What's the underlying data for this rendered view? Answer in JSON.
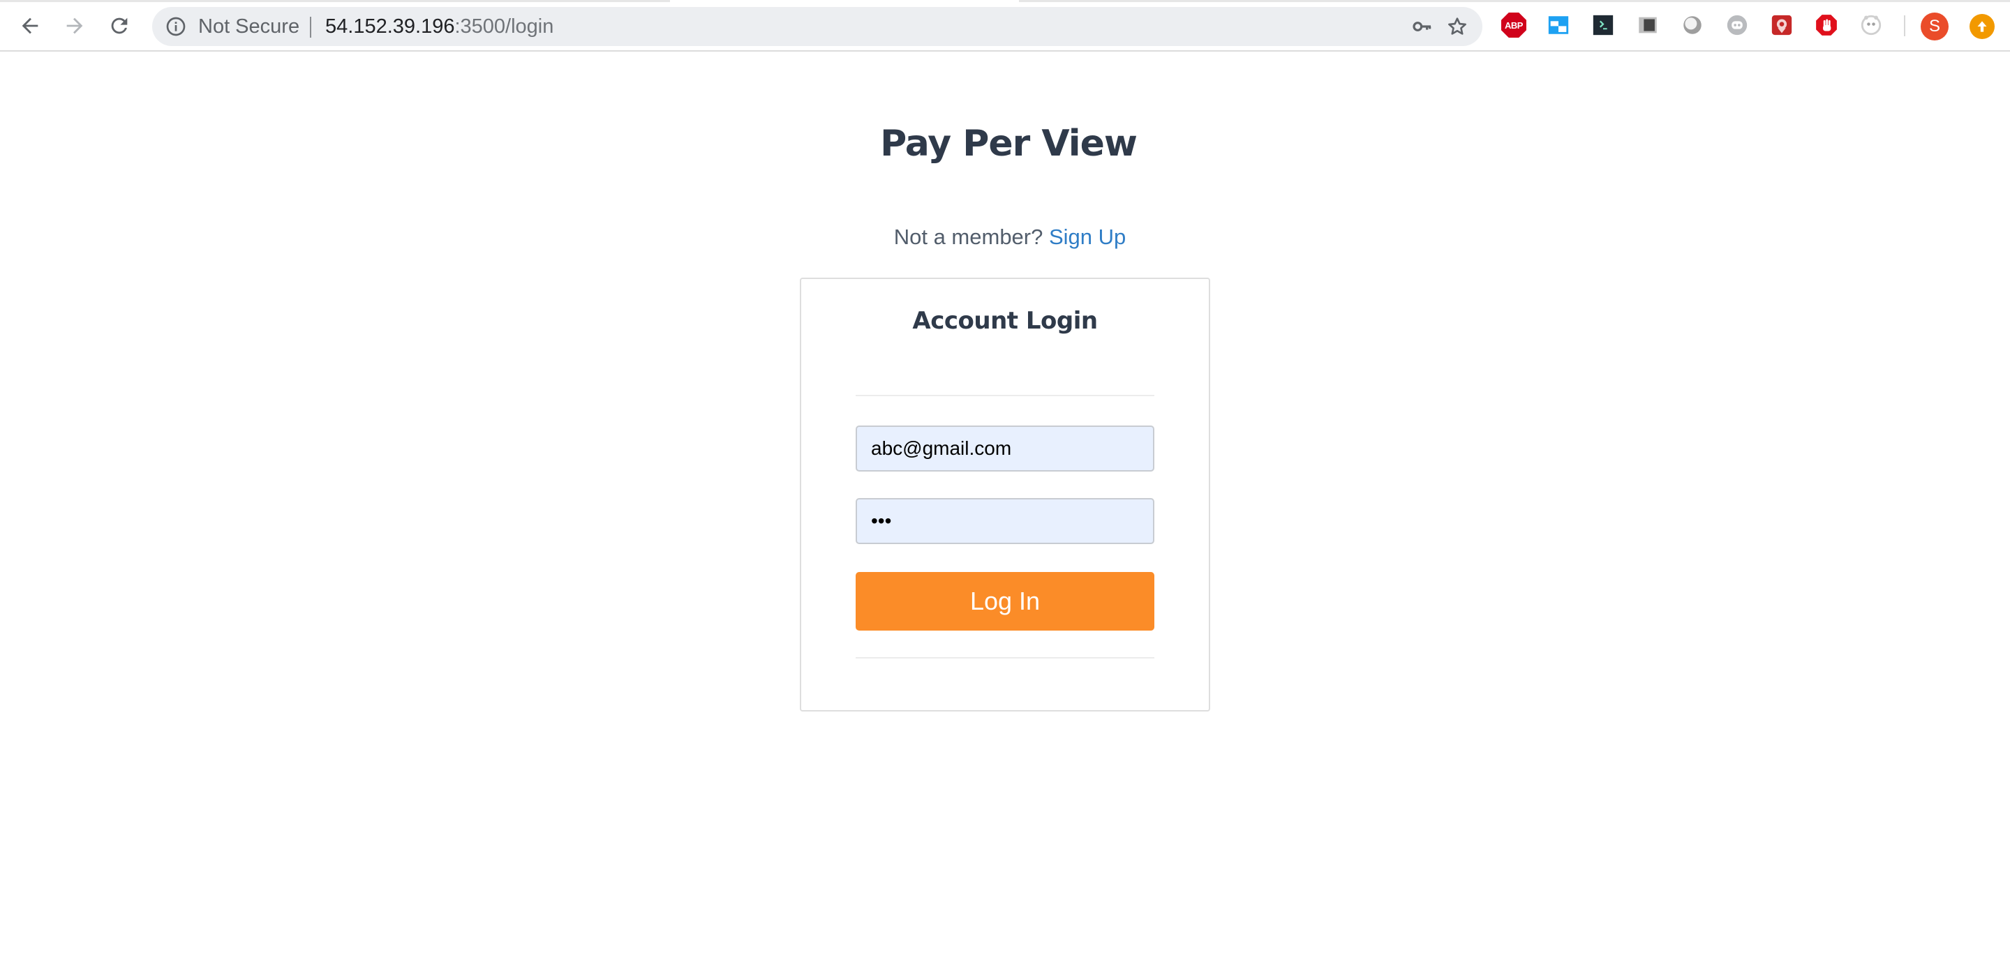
{
  "browser": {
    "security_label": "Not Secure",
    "url_host": "54.152.39.196",
    "url_rest": ":3500/login",
    "nav_icons": [
      "back-arrow-icon",
      "forward-arrow-icon",
      "reload-icon"
    ],
    "omnibox_icons": [
      "info-icon",
      "key-icon",
      "star-icon"
    ],
    "extensions": [
      {
        "name": "adblock-plus-icon",
        "label": "ABP",
        "color": "#d0021b"
      },
      {
        "name": "window-extension-icon",
        "color": "#1da1f2"
      },
      {
        "name": "terminal-extension-icon",
        "color": "#1f2a33"
      },
      {
        "name": "film-extension-icon",
        "color": "#555555"
      },
      {
        "name": "circle-extension-icon",
        "color": "#9e9e9e"
      },
      {
        "name": "discord-extension-icon",
        "color": "#b9bbbe"
      },
      {
        "name": "puzzle-red-extension-icon",
        "color": "#c62828"
      },
      {
        "name": "hand-stop-extension-icon",
        "color": "#e0101c"
      },
      {
        "name": "panda-extension-icon",
        "color": "#cfcfcf"
      }
    ],
    "avatar_letter": "S",
    "avatar_color": "#ea4c2a",
    "update_icon": "arrow-up-icon",
    "update_color": "#f29900"
  },
  "page": {
    "title": "Pay Per View",
    "signup_prompt": "Not a member?",
    "signup_link": "Sign Up"
  },
  "login_card": {
    "title": "Account Login",
    "email_value": "abc@gmail.com",
    "password_value": "abc",
    "submit_label": "Log In",
    "accent_color": "#fb8c28"
  }
}
